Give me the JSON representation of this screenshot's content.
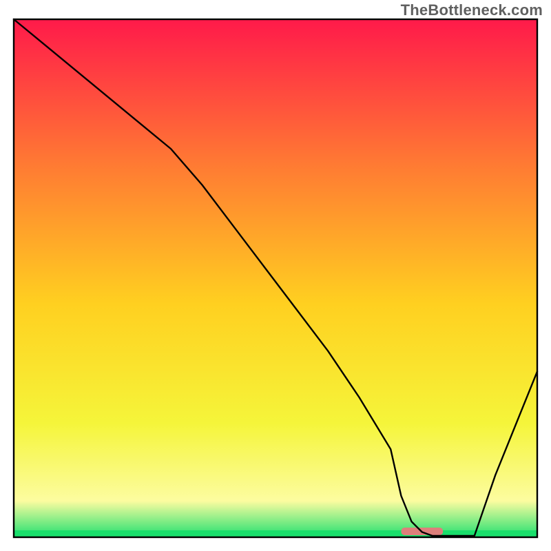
{
  "watermark": "TheBottleneck.com",
  "chart_data": {
    "type": "line",
    "title": "",
    "xlabel": "",
    "ylabel": "",
    "xlim": [
      0,
      100
    ],
    "ylim": [
      0,
      100
    ],
    "x": [
      0,
      6,
      12,
      18,
      24,
      30,
      36,
      42,
      48,
      54,
      60,
      66,
      72,
      74,
      76,
      78,
      80,
      84,
      88,
      92,
      96,
      100
    ],
    "values": [
      100,
      95,
      90,
      85,
      80,
      75,
      68,
      60,
      52,
      44,
      36,
      27,
      17,
      8,
      3,
      1,
      0,
      0,
      0,
      12,
      22,
      32
    ],
    "grid": false,
    "legend": false,
    "marker": {
      "x_start": 74,
      "x_end": 82,
      "y": 0,
      "color": "#de7f7b"
    },
    "gradient_stops": {
      "top": "#ff1a4a",
      "upper_mid": "#ff7a33",
      "mid": "#ffd020",
      "lower_mid": "#f5f53a",
      "near_bottom": "#fcfca0",
      "bottom": "#20e070"
    },
    "frame_color": "#000000",
    "curve_color": "#000000"
  }
}
